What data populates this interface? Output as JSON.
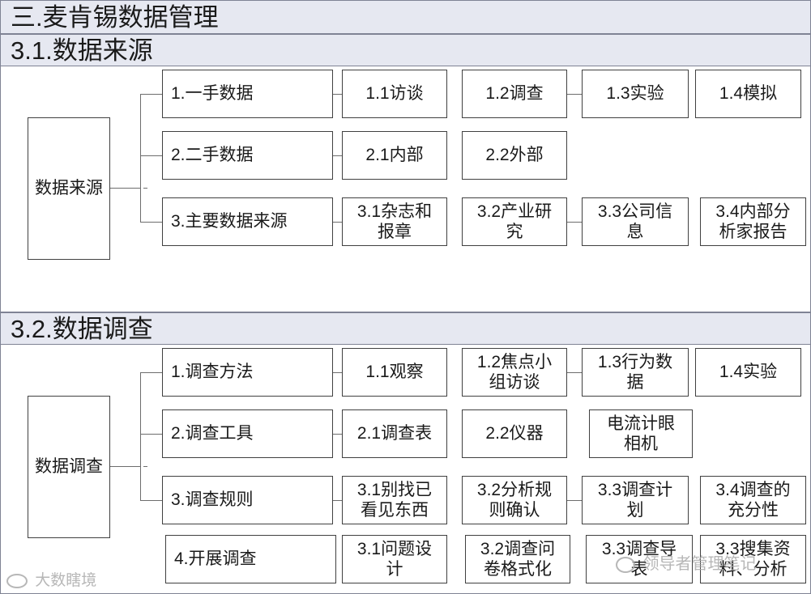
{
  "page_header": "三.麦肯锡数据管理",
  "section1": {
    "title": "3.1.数据来源",
    "root": "数据来源",
    "rows": [
      {
        "label": "1.一手数据",
        "items": [
          "1.1访谈",
          "1.2调查",
          "1.3实验",
          "1.4模拟"
        ]
      },
      {
        "label": "2.二手数据",
        "items": [
          "2.1内部",
          "2.2外部"
        ]
      },
      {
        "label": "3.主要数据来源",
        "items": [
          "3.1杂志和报章",
          "3.2产业研究",
          "3.3公司信息",
          "3.4内部分析家报告"
        ]
      }
    ]
  },
  "section2": {
    "title": "3.2.数据调查",
    "root": "数据调查",
    "rows": [
      {
        "label": "1.调查方法",
        "items": [
          "1.1观察",
          "1.2焦点小组访谈",
          "1.3行为数据",
          "1.4实验"
        ]
      },
      {
        "label": "2.调查工具",
        "items": [
          "2.1调查表",
          "2.2仪器",
          "电流计眼相机"
        ]
      },
      {
        "label": "3.调查规则",
        "items": [
          "3.1别找已看见东西",
          "3.2分析规则确认",
          "3.3调查计划",
          "3.4调查的充分性"
        ]
      },
      {
        "label": "4.开展调查",
        "items": [
          "3.1问题设计",
          "3.2调查问卷格式化",
          "3.3调查导表",
          "3.3搜集资料、分析"
        ]
      }
    ]
  },
  "watermarks": {
    "left": "大数瞎境",
    "right": "领导者管理笔记"
  }
}
